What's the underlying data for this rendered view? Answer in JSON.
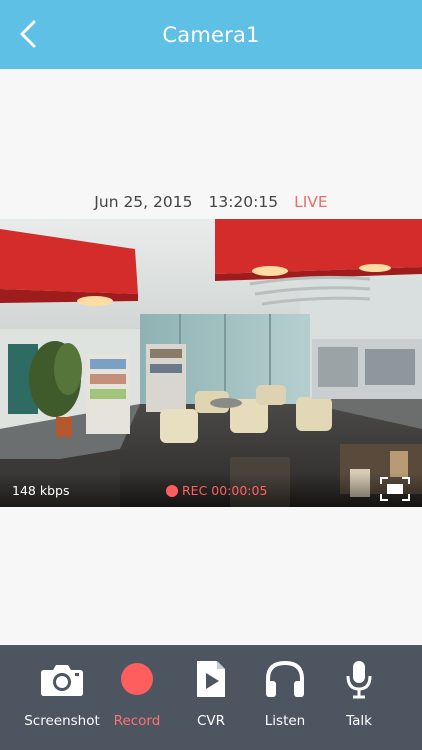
{
  "header": {
    "title": "Camera1"
  },
  "timestamp": {
    "date": "Jun 25, 2015",
    "time": "13:20:15",
    "live_label": "LIVE"
  },
  "video": {
    "bitrate": "148 kbps",
    "rec_label": "REC 00:00:05"
  },
  "toolbar": {
    "items": [
      {
        "label": "Screenshot",
        "icon": "camera-icon"
      },
      {
        "label": "Record",
        "icon": "record-icon"
      },
      {
        "label": "CVR",
        "icon": "play-file-icon"
      },
      {
        "label": "Listen",
        "icon": "headphones-icon"
      },
      {
        "label": "Talk",
        "icon": "microphone-icon"
      }
    ]
  },
  "colors": {
    "header": "#5fc0e6",
    "toolbar": "#4c5560",
    "live": "#ef6c6c",
    "record": "#ff5e5e",
    "background": "#f7f7f7"
  }
}
